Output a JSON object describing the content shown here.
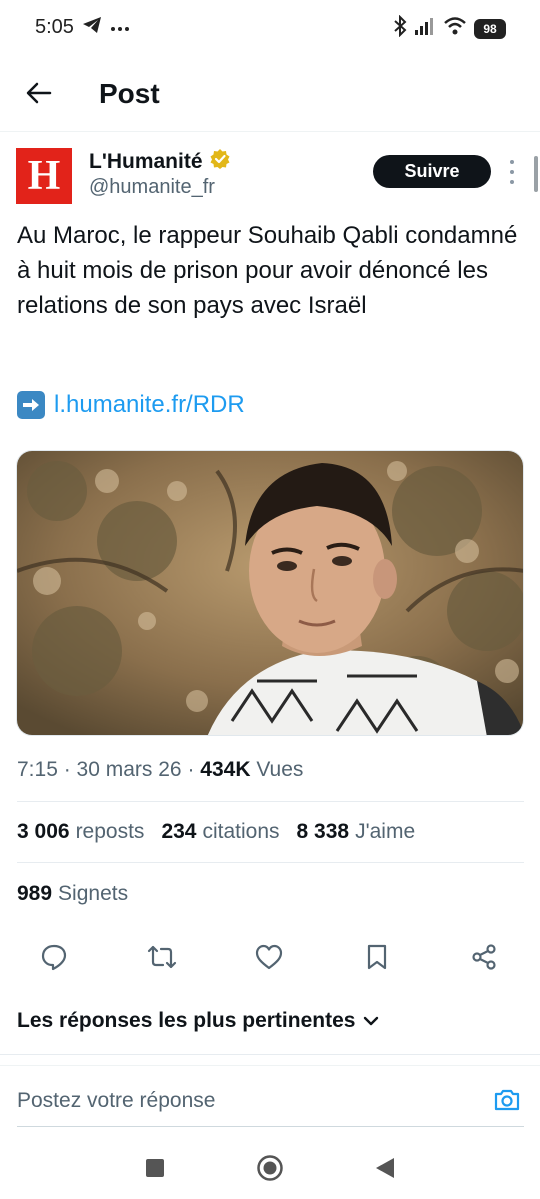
{
  "status_bar": {
    "time": "5:05",
    "battery": "98",
    "icons": [
      "telegram-icon",
      "more-notifications-icon",
      "bluetooth-icon",
      "signal-icon",
      "wifi-icon",
      "battery-icon"
    ]
  },
  "header": {
    "title": "Post"
  },
  "author": {
    "avatar_letter": "H",
    "display_name": "L'Humanité",
    "handle": "@humanite_fr",
    "verified": true,
    "follow_label": "Suivre"
  },
  "tweet": {
    "text": "Au Maroc, le rappeur Souhaib Qabli condamné à huit mois de prison pour avoir dénoncé les relations de son pays avec Israël",
    "link": "l.humanite.fr/RDR"
  },
  "meta": {
    "time": "7:15",
    "date": "30 mars 26",
    "views_count": "434K",
    "views_label": "Vues"
  },
  "stats": {
    "reposts_count": "3 006",
    "reposts_label": "reposts",
    "quotes_count": "234",
    "quotes_label": "citations",
    "likes_count": "8 338",
    "likes_label": "J'aime",
    "bookmarks_count": "989",
    "bookmarks_label": "Signets"
  },
  "replies": {
    "sort_label": "Les réponses les plus pertinentes",
    "placeholder": "Postez votre réponse"
  },
  "colors": {
    "accent": "#1d9bf0",
    "brand_red": "#e2231a",
    "text_primary": "#0f1419",
    "text_secondary": "#536471",
    "verified_gold": "#e2b719"
  }
}
